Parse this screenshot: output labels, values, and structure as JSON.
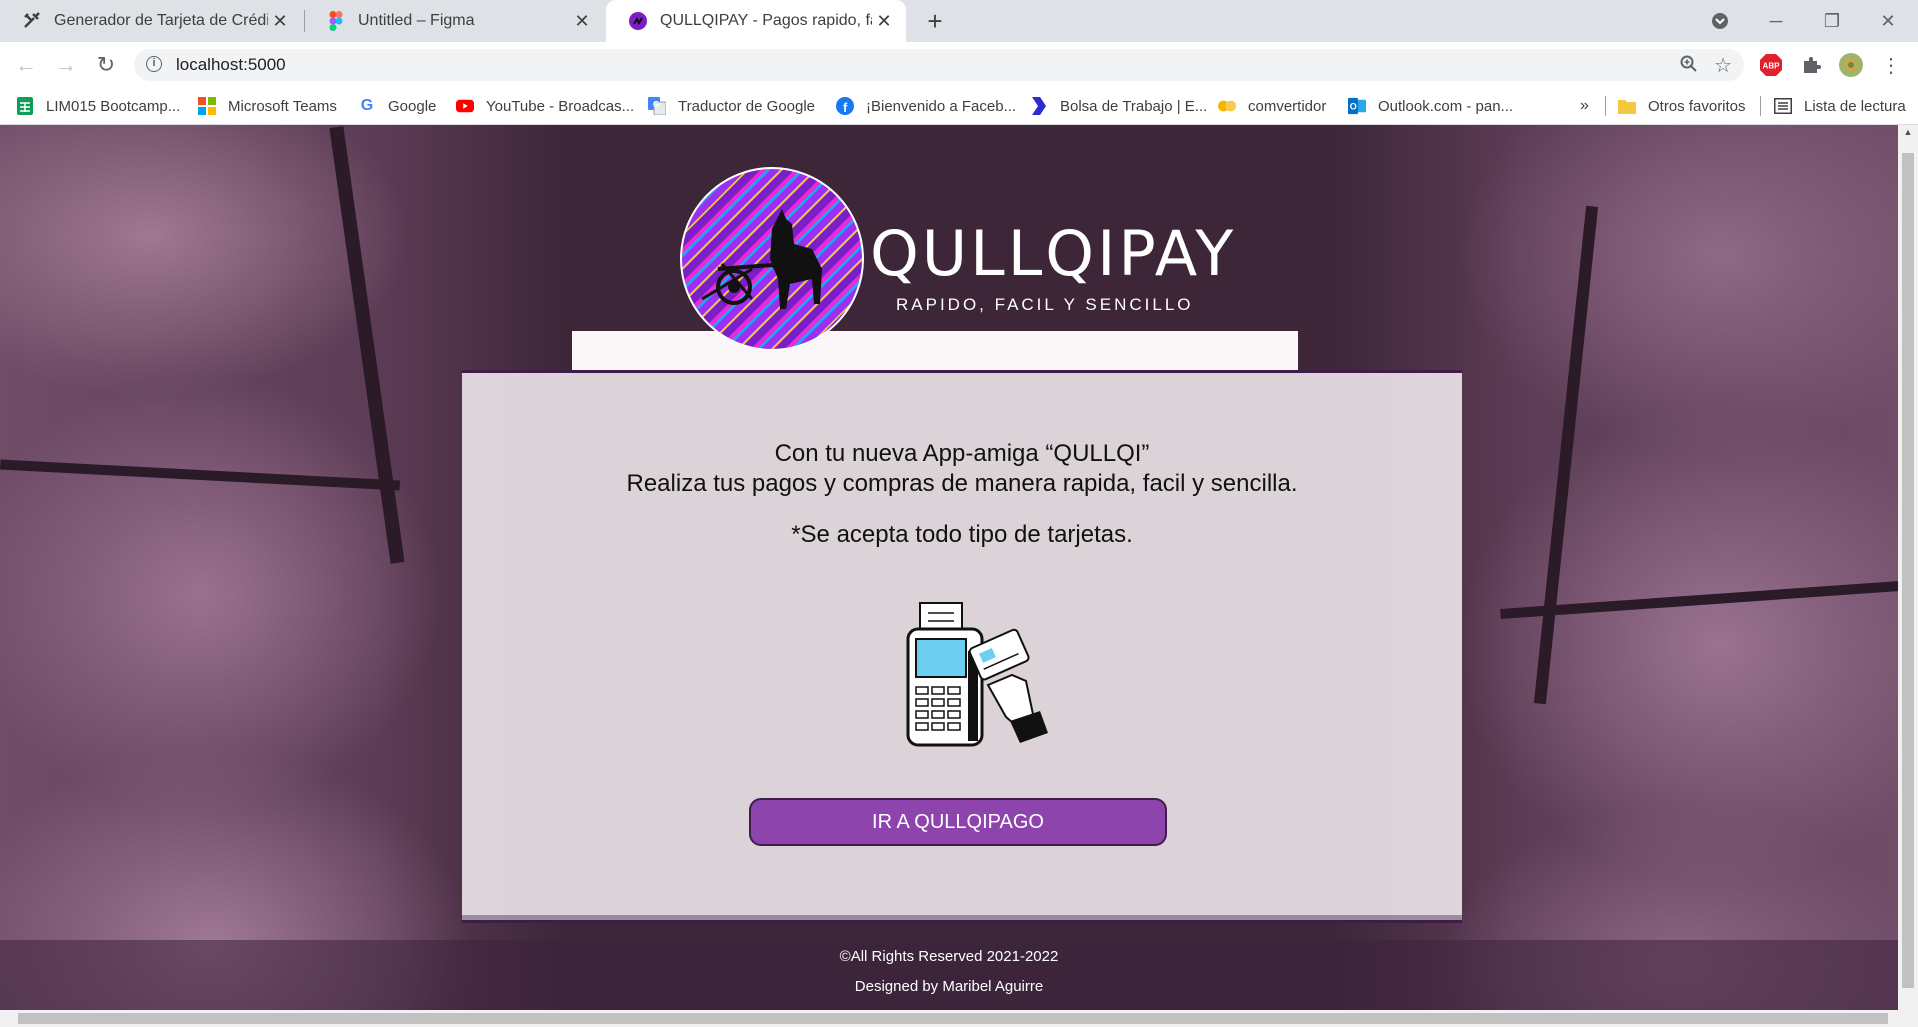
{
  "browser": {
    "tabs": [
      {
        "title": "Generador de Tarjeta de Crédito",
        "icon": "tools-icon"
      },
      {
        "title": "Untitled – Figma",
        "icon": "figma-icon"
      },
      {
        "title": "QULLQIPAY - Pagos rapido, facil y",
        "icon": "qullqipay-icon",
        "active": true
      }
    ],
    "url": "localhost:5000",
    "bookmarks": [
      {
        "label": "LIM015 Bootcamp...",
        "icon": "sheets-icon",
        "color": "#0f9d58"
      },
      {
        "label": "Microsoft Teams",
        "icon": "microsoft-icon",
        "color": "#f25022"
      },
      {
        "label": "Google",
        "icon": "google-icon",
        "color": "#4285f4"
      },
      {
        "label": "YouTube - Broadcas...",
        "icon": "youtube-icon",
        "color": "#ff0000"
      },
      {
        "label": "Traductor de Google",
        "icon": "translate-icon",
        "color": "#4285f4"
      },
      {
        "label": "¡Bienvenido a Faceb...",
        "icon": "facebook-icon",
        "color": "#1877f2"
      },
      {
        "label": "Bolsa de Trabajo | E...",
        "icon": "arrow-logo-icon",
        "color": "#2d2ad1"
      },
      {
        "label": "comvertidor",
        "icon": "converter-icon",
        "color": "#f4b400"
      },
      {
        "label": "Outlook.com - pan...",
        "icon": "outlook-icon",
        "color": "#0072c6"
      }
    ],
    "more_bookmarks": "»",
    "other_favorites": "Otros favoritos",
    "reading_list": "Lista de lectura"
  },
  "page": {
    "brand": "QULLQIPAY",
    "tagline": "RAPIDO, FACIL Y SENCILLO",
    "intro_line1": "Con tu nueva App-amiga “QULLQI”",
    "intro_line2": "Realiza tus pagos y compras de manera rapida, facil y sencilla.",
    "note": "*Se acepta todo tipo de tarjetas.",
    "cta_label": "IR A QULLQIPAGO",
    "footer_line1": "©All Rights Reserved 2021-2022",
    "footer_line2": "Designed by Maribel Aguirre",
    "accent_color": "#8e44ad",
    "border_color": "#3f1d4a"
  }
}
